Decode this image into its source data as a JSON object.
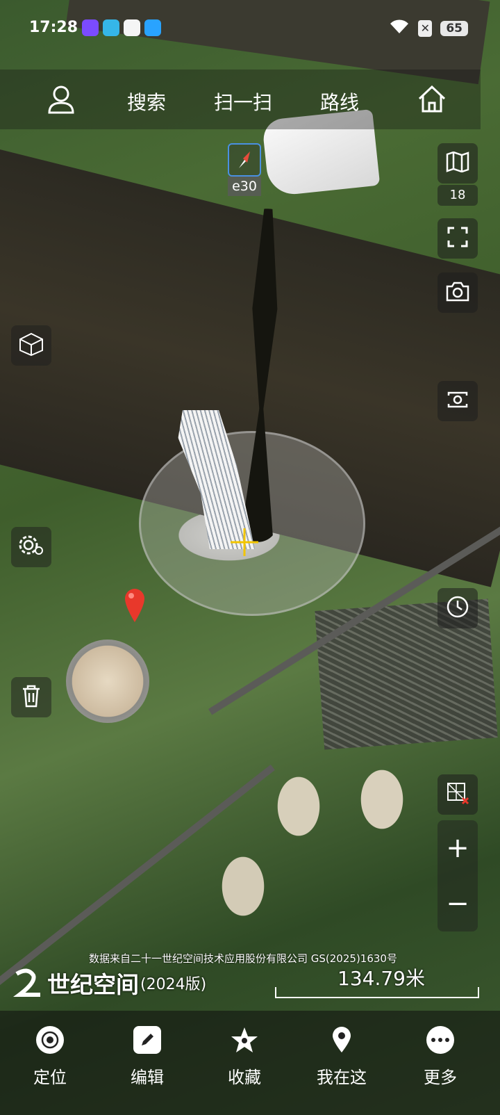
{
  "status_bar": {
    "time": "17:28",
    "battery": "65"
  },
  "topbar": {
    "search": "搜索",
    "scan": "扫一扫",
    "route": "路线"
  },
  "compass": {
    "label": "e30"
  },
  "map_tools": {
    "zoom_level": "18"
  },
  "zoom": {
    "in": "+",
    "out": "−"
  },
  "attribution": "数据来自二十一世纪空间技术应用股份有限公司 GS(2025)1630号",
  "brand": {
    "name": "世纪空间",
    "version": "(2024版)"
  },
  "scale": {
    "label": "134.79米"
  },
  "bottom_nav": [
    {
      "label": "定位",
      "icon": "locate-icon"
    },
    {
      "label": "编辑",
      "icon": "edit-icon"
    },
    {
      "label": "收藏",
      "icon": "favorite-icon"
    },
    {
      "label": "我在这",
      "icon": "i-am-here-icon"
    },
    {
      "label": "更多",
      "icon": "more-icon"
    }
  ],
  "colors": {
    "accent": "#4a90e2",
    "crosshair": "#f2c500",
    "pin": "#e8382b"
  }
}
